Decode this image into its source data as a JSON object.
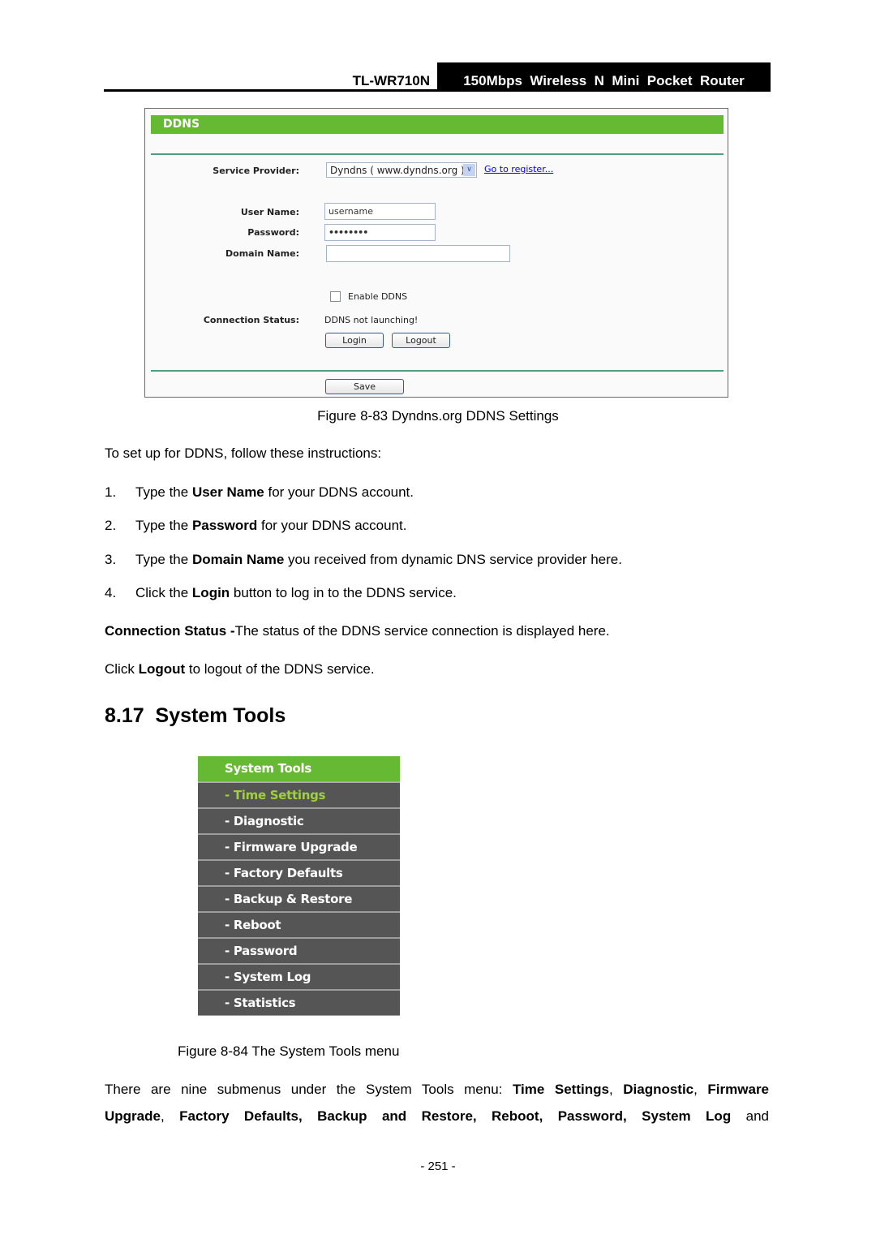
{
  "header": {
    "model": "TL-WR710N",
    "product": "150Mbps  Wireless  N  Mini  Pocket  Router"
  },
  "ddns_panel": {
    "title": "DDNS",
    "service_provider_label": "Service Provider:",
    "service_provider_value": "Dyndns ( www.dyndns.org )",
    "register_link": "Go to register...",
    "user_name_label": "User Name:",
    "user_name_value": "username",
    "password_label": "Password:",
    "password_value": "••••••••",
    "domain_name_label": "Domain Name:",
    "domain_name_value": "",
    "enable_ddns_label": "Enable DDNS",
    "enable_ddns_checked": false,
    "connection_status_label": "Connection Status:",
    "connection_status_value": "DDNS not launching!",
    "login_button": "Login",
    "logout_button": "Logout",
    "save_button": "Save"
  },
  "figure_83_caption": "Figure 8-83 Dyndns.org DDNS Settings",
  "intro": "To set up for DDNS, follow these instructions:",
  "steps": [
    {
      "num": "1.",
      "pre": "Type the ",
      "bold": "User Name",
      "post": " for your DDNS account."
    },
    {
      "num": "2.",
      "pre": "Type the ",
      "bold": "Password",
      "post": " for your DDNS account."
    },
    {
      "num": "3.",
      "pre": "Type the ",
      "bold": "Domain Name",
      "post": " you received from dynamic DNS service provider here."
    },
    {
      "num": "4.",
      "pre": "Click the ",
      "bold": "Login",
      "post": " button to log in to the DDNS service."
    }
  ],
  "connection_status_para": {
    "bold": "Connection Status -",
    "text": "The status of the DDNS service connection is displayed here."
  },
  "logout_para": {
    "pre": "Click ",
    "bold": "Logout",
    "post": " to logout of the DDNS service."
  },
  "section_title": "8.17  System Tools",
  "system_tools_menu": {
    "title": "System Tools",
    "items": [
      {
        "label": "- Time Settings",
        "active": true
      },
      {
        "label": "- Diagnostic",
        "active": false
      },
      {
        "label": "- Firmware Upgrade",
        "active": false
      },
      {
        "label": "- Factory Defaults",
        "active": false
      },
      {
        "label": "- Backup & Restore",
        "active": false
      },
      {
        "label": "- Reboot",
        "active": false
      },
      {
        "label": "- Password",
        "active": false
      },
      {
        "label": "- System Log",
        "active": false
      },
      {
        "label": "- Statistics",
        "active": false
      }
    ]
  },
  "figure_84_caption": "Figure 8-84 The System Tools menu",
  "summary": {
    "line1_pre": "There are nine submenus under the System Tools menu: ",
    "b1": "Time Settings",
    "s1": ", ",
    "b2": "Diagnostic",
    "s2": ", ",
    "b3": "Firmware",
    "line2_b1": "Upgrade",
    "line2_s1": ", ",
    "line2_b2": "Factory Defaults, Backup and Restore, Reboot, Password, System Log",
    "line2_post": " and"
  },
  "page_number": "- 251 -"
}
